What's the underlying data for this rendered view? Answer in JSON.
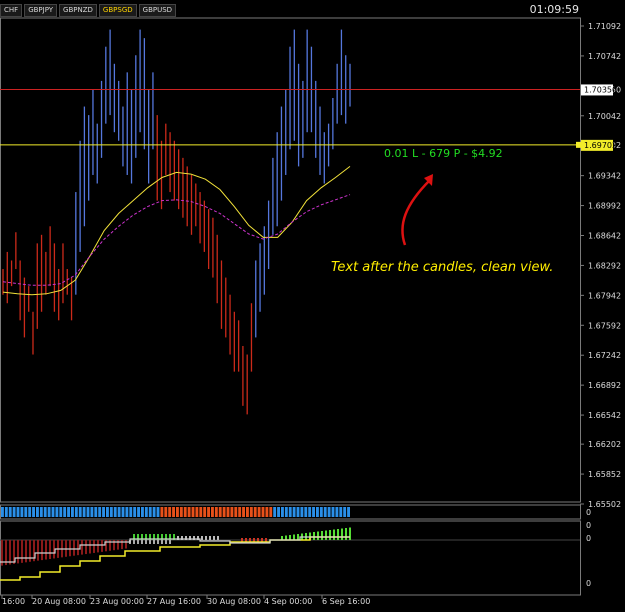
{
  "tabs": [
    {
      "label": "CHF",
      "active": false
    },
    {
      "label": "GBPJPY",
      "active": false
    },
    {
      "label": "GBPNZD",
      "active": false
    },
    {
      "label": "GBPSGD",
      "active": true
    },
    {
      "label": "GBPUSD",
      "active": false
    }
  ],
  "clock": "01:09:59",
  "colors": {
    "bull": "#5577dd",
    "bear": "#cc2a1a",
    "ma_fast": "#f2e23a",
    "ma_slow": "#cc33cc",
    "hline_red": "#cc2222",
    "hline_yellow": "#f2ec2a",
    "accent_green": "#22dd22",
    "annotation": "#ffee00",
    "arrow": "#dd1111",
    "axis": "#7a7a7a"
  },
  "price_axis": {
    "ticks": [
      "1.71092",
      "1.70742",
      "1.70350",
      "1.70042",
      "1.69702",
      "1.69342",
      "1.68992",
      "1.68642",
      "1.68292",
      "1.67942",
      "1.67592",
      "1.67242",
      "1.66892",
      "1.66542",
      "1.66202",
      "1.65852",
      "1.65502"
    ],
    "red_line_label": "1.70350",
    "yellow_line_label": "1.69702"
  },
  "position_label": "0.01 L - 679 P - $4.92",
  "annotation": "Text after the candles, clean view.",
  "indicator_labels": [
    "0",
    "0",
    "0",
    "0"
  ],
  "time_axis": [
    "16:00",
    "20 Aug 08:00",
    "23 Aug 00:00",
    "27 Aug 16:00",
    "30 Aug 08:00",
    "4 Sep 00:00",
    "6 Sep 16:00"
  ],
  "chart_data": {
    "type": "candlestick",
    "ylim": [
      1.65502,
      1.71092
    ],
    "hlines": [
      1.7035,
      1.69702
    ],
    "series_highlow": [
      [
        1.6795,
        1.6825
      ],
      [
        1.6785,
        1.6845
      ],
      [
        1.6805,
        1.6835
      ],
      [
        1.6825,
        1.6868
      ],
      [
        1.6765,
        1.6835
      ],
      [
        1.6745,
        1.6815
      ],
      [
        1.6775,
        1.6805
      ],
      [
        1.6725,
        1.6775
      ],
      [
        1.6755,
        1.6855
      ],
      [
        1.6775,
        1.6865
      ],
      [
        1.6795,
        1.6845
      ],
      [
        1.6805,
        1.6875
      ],
      [
        1.6775,
        1.6855
      ],
      [
        1.6765,
        1.6825
      ],
      [
        1.6785,
        1.6855
      ],
      [
        1.6795,
        1.6825
      ],
      [
        1.6765,
        1.6815
      ],
      [
        1.6795,
        1.6915
      ],
      [
        1.6845,
        1.6975
      ],
      [
        1.6875,
        1.7015
      ],
      [
        1.6905,
        1.7005
      ],
      [
        1.6935,
        1.7035
      ],
      [
        1.6925,
        1.6995
      ],
      [
        1.6955,
        1.7045
      ],
      [
        1.6995,
        1.7085
      ],
      [
        1.7005,
        1.7105
      ],
      [
        1.6985,
        1.7065
      ],
      [
        1.6975,
        1.7045
      ],
      [
        1.6945,
        1.7015
      ],
      [
        1.6935,
        1.7055
      ],
      [
        1.6925,
        1.7035
      ],
      [
        1.6955,
        1.7075
      ],
      [
        1.6985,
        1.7105
      ],
      [
        1.6965,
        1.7095
      ],
      [
        1.6925,
        1.7035
      ],
      [
        1.6965,
        1.7055
      ],
      [
        1.6905,
        1.7005
      ],
      [
        1.6895,
        1.6975
      ],
      [
        1.6935,
        1.6995
      ],
      [
        1.6915,
        1.6985
      ],
      [
        1.6905,
        1.6975
      ],
      [
        1.6895,
        1.6965
      ],
      [
        1.6885,
        1.6955
      ],
      [
        1.6875,
        1.6945
      ],
      [
        1.6865,
        1.6935
      ],
      [
        1.6875,
        1.6925
      ],
      [
        1.6855,
        1.6915
      ],
      [
        1.6845,
        1.6905
      ],
      [
        1.6825,
        1.6895
      ],
      [
        1.6815,
        1.6885
      ],
      [
        1.6785,
        1.6865
      ],
      [
        1.6755,
        1.6835
      ],
      [
        1.6745,
        1.6815
      ],
      [
        1.6725,
        1.6795
      ],
      [
        1.6705,
        1.6775
      ],
      [
        1.6705,
        1.6765
      ],
      [
        1.6665,
        1.6735
      ],
      [
        1.6655,
        1.6725
      ],
      [
        1.6705,
        1.6785
      ],
      [
        1.6745,
        1.6835
      ],
      [
        1.6775,
        1.6855
      ],
      [
        1.6795,
        1.6875
      ],
      [
        1.6825,
        1.6905
      ],
      [
        1.6865,
        1.6955
      ],
      [
        1.6875,
        1.6985
      ],
      [
        1.6905,
        1.7015
      ],
      [
        1.6935,
        1.7035
      ],
      [
        1.6965,
        1.7085
      ],
      [
        1.6975,
        1.7105
      ],
      [
        1.6945,
        1.7065
      ],
      [
        1.6955,
        1.7045
      ],
      [
        1.6985,
        1.7105
      ],
      [
        1.6985,
        1.7085
      ],
      [
        1.6955,
        1.7045
      ],
      [
        1.6935,
        1.7015
      ],
      [
        1.6925,
        1.6985
      ],
      [
        1.6945,
        1.6995
      ],
      [
        1.6965,
        1.7025
      ],
      [
        1.6995,
        1.7065
      ],
      [
        1.7005,
        1.7105
      ],
      [
        1.6995,
        1.7075
      ],
      [
        1.7015,
        1.7065
      ]
    ],
    "ma_fast": [
      1.6798,
      1.6796,
      1.6795,
      1.6796,
      1.68,
      1.6812,
      1.684,
      1.687,
      1.689,
      1.6905,
      1.692,
      1.6932,
      1.6938,
      1.6936,
      1.693,
      1.6918,
      1.6898,
      1.6876,
      1.6862,
      1.6862,
      1.688,
      1.6905,
      1.692,
      1.6932,
      1.6945
    ],
    "ma_slow": [
      1.681,
      1.6808,
      1.6806,
      1.6806,
      1.6808,
      1.6818,
      1.684,
      1.686,
      1.6875,
      1.6888,
      1.6898,
      1.6905,
      1.6906,
      1.6904,
      1.6898,
      1.689,
      1.6878,
      1.6866,
      1.686,
      1.6866,
      1.688,
      1.6892,
      1.69,
      1.6906,
      1.6912
    ]
  }
}
